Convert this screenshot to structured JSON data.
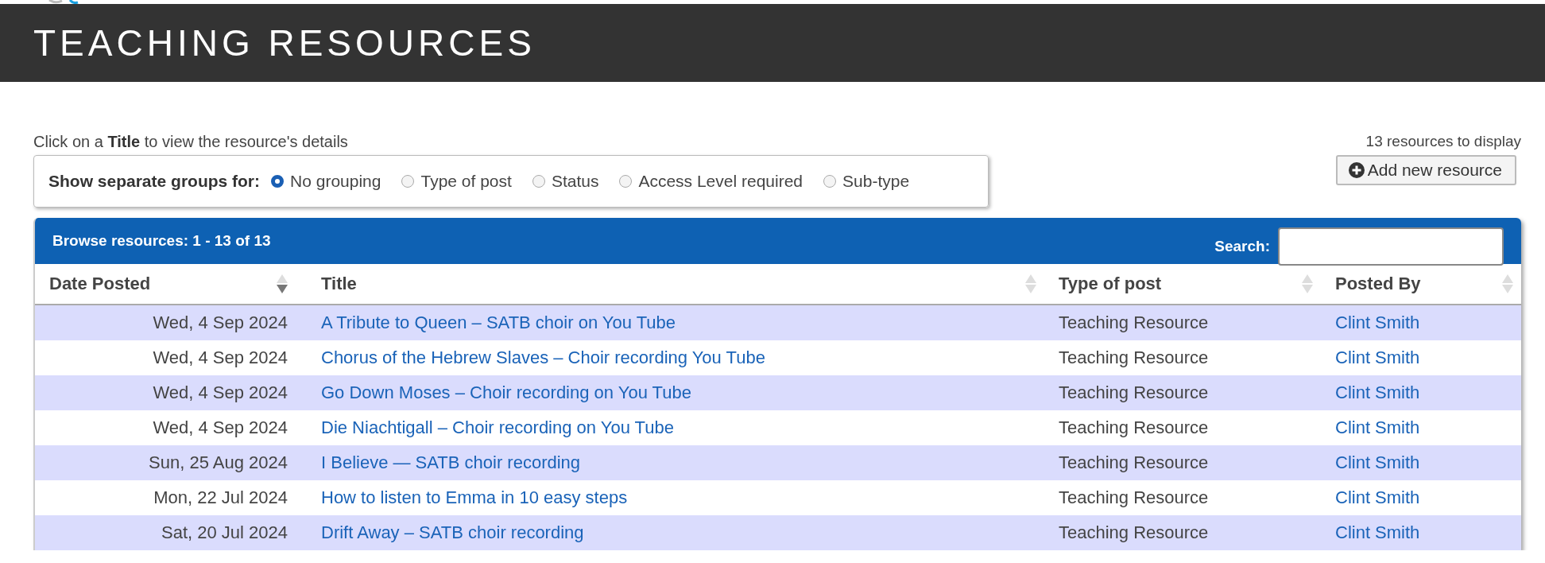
{
  "header": {
    "title": "TEACHING RESOURCES"
  },
  "intro": "Click on a **Title** to view the resource's details",
  "resource_count": "13 resources to display",
  "add_button": "Add new resource",
  "grouping": {
    "label": "Show separate groups for:",
    "options": [
      {
        "label": "No grouping",
        "selected": true
      },
      {
        "label": "Type of post",
        "selected": false
      },
      {
        "label": "Status",
        "selected": false
      },
      {
        "label": "Access Level required",
        "selected": false
      },
      {
        "label": "Sub-type",
        "selected": false
      }
    ]
  },
  "table": {
    "caption": "Browse resources: 1 - 13 of 13",
    "search": {
      "label": "Search:"
    },
    "columns": [
      {
        "label": "Date Posted",
        "sorted": true
      },
      {
        "label": "Title",
        "sorted": false
      },
      {
        "label": "Type of post",
        "sorted": false
      },
      {
        "label": "Posted By",
        "sorted": false
      }
    ],
    "rows": [
      {
        "date": "Wed, 4 Sep 2024",
        "title": "A Tribute to Queen – SATB choir on You Tube",
        "type": "Teaching Resource",
        "posted_by": "Clint Smith"
      },
      {
        "date": "Wed, 4 Sep 2024",
        "title": "Chorus of the Hebrew Slaves – Choir recording You Tube",
        "type": "Teaching Resource",
        "posted_by": "Clint Smith"
      },
      {
        "date": "Wed, 4 Sep 2024",
        "title": "Go Down Moses – Choir recording on You Tube",
        "type": "Teaching Resource",
        "posted_by": "Clint Smith"
      },
      {
        "date": "Wed, 4 Sep 2024",
        "title": "Die Niachtigall – Choir recording on You Tube",
        "type": "Teaching Resource",
        "posted_by": "Clint Smith"
      },
      {
        "date": "Sun, 25 Aug 2024",
        "title": "I Believe — SATB choir recording",
        "type": "Teaching Resource",
        "posted_by": "Clint Smith"
      },
      {
        "date": "Mon, 22 Jul 2024",
        "title": "How to listen to Emma in 10 easy steps",
        "type": "Teaching Resource",
        "posted_by": "Clint Smith"
      },
      {
        "date": "Sat, 20 Jul 2024",
        "title": "Drift Away – SATB choir recording",
        "type": "Teaching Resource",
        "posted_by": "Clint Smith"
      }
    ]
  }
}
